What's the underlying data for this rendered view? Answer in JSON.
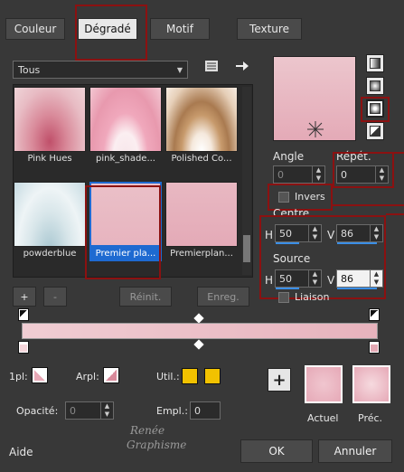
{
  "tabs": [
    {
      "label": "Couleur"
    },
    {
      "label": "Dégradé"
    },
    {
      "label": "Motif"
    },
    {
      "label": "Texture"
    }
  ],
  "category_select": {
    "value": "Tous"
  },
  "gradients": [
    {
      "label": "Pink Hues"
    },
    {
      "label": "pink_shade..."
    },
    {
      "label": "Polished Co..."
    },
    {
      "label": "powderblue"
    },
    {
      "label": "Premier pla..."
    },
    {
      "label": "Premierplan..."
    }
  ],
  "list_buttons": {
    "add": "+",
    "remove": "-",
    "reset": "Réinit.",
    "save": "Enreg."
  },
  "angle": {
    "label": "Angle",
    "value": "0"
  },
  "repeat": {
    "label": "Répét.",
    "value": "0"
  },
  "invert": {
    "label": "Invers"
  },
  "center": {
    "label": "Centre",
    "h_label": "H",
    "h_value": "50",
    "v_label": "V",
    "v_value": "86"
  },
  "source": {
    "label": "Source",
    "h_label": "H",
    "h_value": "50",
    "v_label": "V",
    "v_value": "86"
  },
  "link": {
    "label": "Liaison"
  },
  "markers": {
    "pl_label": "1pl:",
    "arpl_label": "Arpl:",
    "util_label": "Util.:",
    "opacity_label": "Opacité:",
    "opacity_value": "0",
    "empl_label": "Empl.:",
    "empl_value": "0"
  },
  "preview": {
    "current_label": "Actuel",
    "previous_label": "Préc.",
    "add": "+"
  },
  "footer": {
    "help": "Aide",
    "ok": "OK",
    "cancel": "Annuler"
  },
  "watermark": {
    "line1": "Renée",
    "line2": "Graphisme"
  },
  "colors": {
    "accent": "#1e6ad1",
    "annotation": "#8b1111",
    "marker_yellow": "#f2c200",
    "gradient_pink": "#e8b4bf"
  }
}
